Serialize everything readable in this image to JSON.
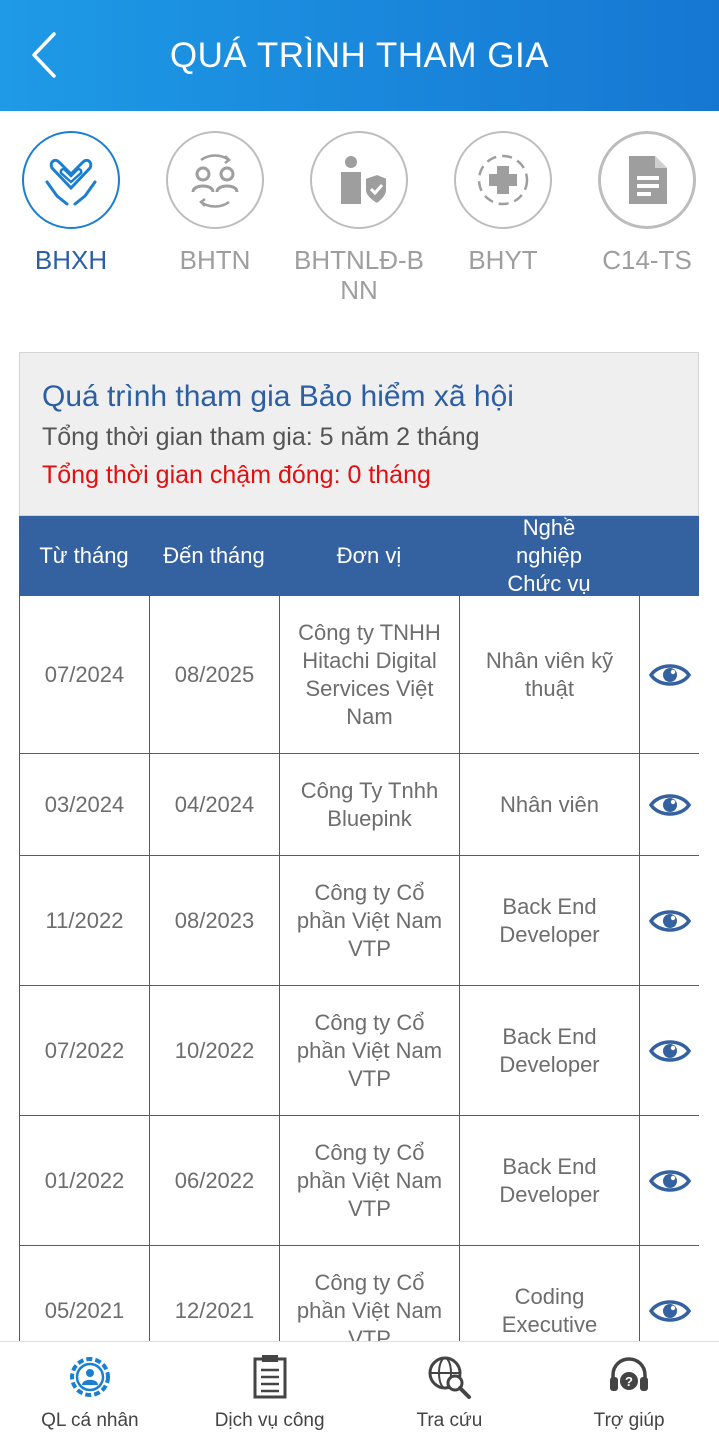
{
  "header": {
    "title": "QUÁ TRÌNH THAM GIA"
  },
  "categories": [
    {
      "label": "BHXH",
      "icon": "hands-heart-icon",
      "active": true
    },
    {
      "label": "BHTN",
      "icon": "people-exchange-icon",
      "active": false
    },
    {
      "label": "BHTNLĐ-BNN",
      "icon": "worker-shield-icon",
      "active": false
    },
    {
      "label": "BHYT",
      "icon": "medical-cross-icon",
      "active": false
    },
    {
      "label": "C14-TS",
      "icon": "document-icon",
      "active": false
    }
  ],
  "summary": {
    "title": "Quá trình tham gia Bảo hiểm xã hội",
    "total": "Tổng thời gian tham gia: 5 năm 2 tháng",
    "late": "Tổng thời gian chậm đóng: 0 tháng"
  },
  "table": {
    "headers": [
      "Từ tháng",
      "Đến tháng",
      "Đơn vị",
      "Nghề nghiệp Chức vụ"
    ],
    "rows": [
      {
        "from": "07/2024",
        "to": "08/2025",
        "unit": "Công ty TNHH Hitachi Digital Services Việt Nam",
        "position": "Nhân viên kỹ thuật"
      },
      {
        "from": "03/2024",
        "to": "04/2024",
        "unit": "Công Ty Tnhh Bluepink",
        "position": "Nhân viên"
      },
      {
        "from": "11/2022",
        "to": "08/2023",
        "unit": "Công ty Cổ phần Việt Nam VTP",
        "position": "Back End Developer"
      },
      {
        "from": "07/2022",
        "to": "10/2022",
        "unit": "Công ty Cổ phần Việt Nam VTP",
        "position": "Back End Developer"
      },
      {
        "from": "01/2022",
        "to": "06/2022",
        "unit": "Công ty Cổ phần Việt Nam VTP",
        "position": "Back End Developer"
      },
      {
        "from": "05/2021",
        "to": "12/2021",
        "unit": "Công ty Cổ phần Việt Nam VTP",
        "position": "Coding Executive"
      }
    ]
  },
  "bottom_nav": [
    {
      "label": "QL cá nhân",
      "icon": "personal-gear-icon",
      "active": true
    },
    {
      "label": "Dịch vụ công",
      "icon": "document-list-icon",
      "active": false
    },
    {
      "label": "Tra cứu",
      "icon": "globe-search-icon",
      "active": false
    },
    {
      "label": "Trợ giúp",
      "icon": "headset-help-icon",
      "active": false
    }
  ],
  "colors": {
    "header_start": "#1e9ae6",
    "header_end": "#1677d2",
    "table_header": "#34619f",
    "accent_text": "#2c5ea5",
    "late_red": "#e01010"
  }
}
